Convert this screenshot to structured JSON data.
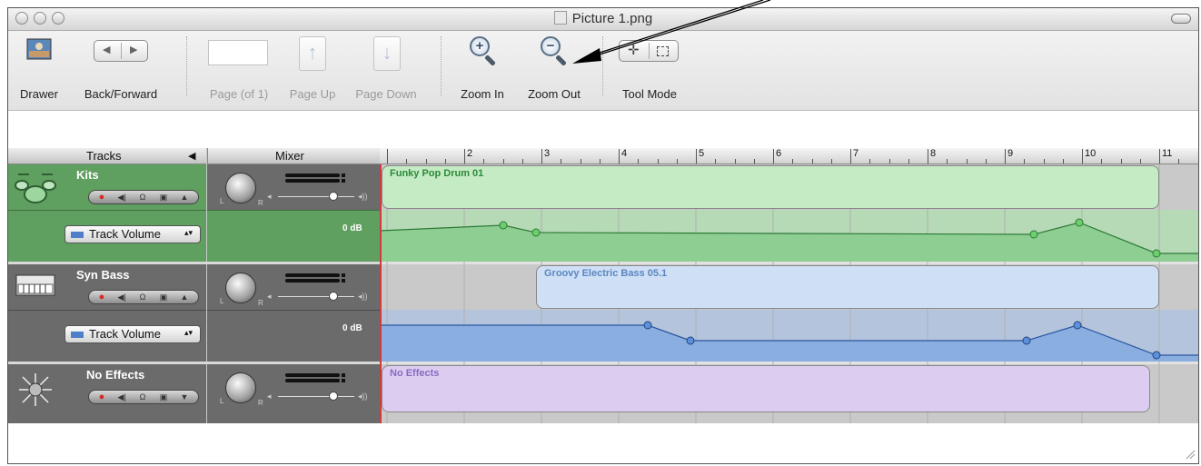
{
  "window": {
    "title": "Picture 1.png"
  },
  "toolbar": {
    "drawer": "Drawer",
    "back_forward": "Back/Forward",
    "page_of": "Page (of 1)",
    "page_up": "Page Up",
    "page_down": "Page Down",
    "zoom_in": "Zoom In",
    "zoom_out": "Zoom Out",
    "tool_mode": "Tool Mode"
  },
  "headers": {
    "tracks": "Tracks",
    "mixer": "Mixer"
  },
  "ruler": {
    "bars": [
      "2",
      "3",
      "4",
      "5",
      "6",
      "7",
      "8",
      "9",
      "10",
      "11"
    ]
  },
  "tracks": [
    {
      "name": "Kits",
      "color": "#5f9f5f",
      "automation_label": "Track Volume",
      "db_label": "0 dB",
      "region_name": "Funky Pop Drum 01",
      "region_color": "#c4ebc4",
      "automation_color": "#8fce93"
    },
    {
      "name": "Syn Bass",
      "color": "#6b6b6b",
      "automation_label": "Track Volume",
      "db_label": "0 dB",
      "region_name": "Groovy Electric Bass 05.1",
      "region_color": "#cfe0f6",
      "automation_color": "#8aaee0"
    },
    {
      "name": "No Effects",
      "color": "#6b6b6b",
      "region_name": "No Effects",
      "region_color": "#dccdf0"
    }
  ],
  "icons": {
    "track_buttons": [
      "record-icon",
      "mute-icon",
      "headphones-icon",
      "lock-icon",
      "expand-arrow-icon"
    ]
  }
}
